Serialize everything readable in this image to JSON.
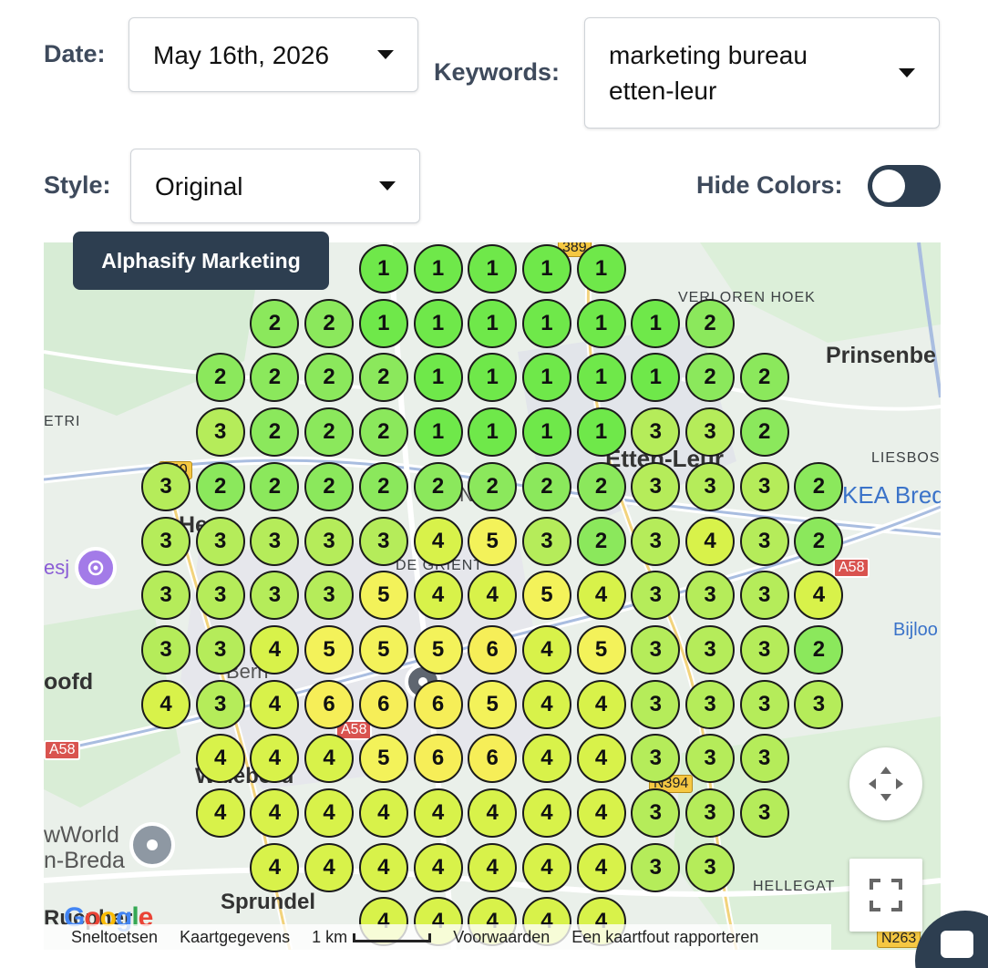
{
  "controls": {
    "date_label": "Date:",
    "date_value": "May 16th, 2026",
    "keywords_label": "Keywords:",
    "keywords_value": "marketing bureau\netten-leur",
    "style_label": "Style:",
    "style_value": "Original",
    "hide_colors_label": "Hide Colors:",
    "hide_colors_on": false
  },
  "map": {
    "tooltip": "Alphasify Marketing",
    "labels": {
      "verloren_hoek": "VERLOREN HOEK",
      "prinsenbeek": "Prinsenbe",
      "etri": "ETRI",
      "liesbos": "LIESBOS",
      "etten_leur": "Etten-Leur",
      "ikea": "KEA Bred",
      "de_grient": "DE GRIENT",
      "bijloop": "Bijloo",
      "hoofd": "oofd",
      "newworld": "wWorld\nn-Breda",
      "hellegat": "HELLEGAT",
      "sprundel": "Sprundel",
      "rucphen": "Rucpher",
      "road_a58_right": "A58",
      "road_a58_left": "A58",
      "road_a58_mid": "A58",
      "road_n394": "N394",
      "road_n263": "N263",
      "road_a389": "389",
      "road_n640": "640",
      "esj": "esj",
      "hoeven": "He",
      "bern": "Bern",
      "leur_mid": "N",
      "wouw": "Walebord"
    },
    "attribution": {
      "shortcuts": "Sneltoetsen",
      "map_data": "Kaartgegevens",
      "scale": "1 km",
      "terms": "Voorwaarden",
      "report": "Een kaartfout rapporteren"
    },
    "colors": {
      "1": "#6fe84a",
      "2": "#8be85c",
      "3": "#b5ec5a",
      "4": "#d8f24a",
      "5": "#f3f25a",
      "6": "#f6ee58"
    }
  },
  "grid": {
    "cols": 13,
    "rows": [
      [
        null,
        null,
        null,
        null,
        1,
        1,
        1,
        1,
        1,
        null,
        null,
        null,
        null
      ],
      [
        null,
        null,
        2,
        2,
        1,
        1,
        1,
        1,
        1,
        1,
        2,
        null,
        null
      ],
      [
        null,
        2,
        2,
        2,
        2,
        1,
        1,
        1,
        1,
        1,
        2,
        2,
        null
      ],
      [
        null,
        3,
        2,
        2,
        2,
        1,
        1,
        1,
        1,
        3,
        3,
        2,
        null
      ],
      [
        3,
        2,
        2,
        2,
        2,
        2,
        2,
        2,
        2,
        3,
        3,
        3,
        2
      ],
      [
        3,
        3,
        3,
        3,
        3,
        4,
        5,
        3,
        2,
        3,
        4,
        3,
        2
      ],
      [
        3,
        3,
        3,
        3,
        5,
        4,
        4,
        5,
        4,
        3,
        3,
        3,
        4
      ],
      [
        3,
        3,
        4,
        5,
        5,
        5,
        6,
        4,
        5,
        3,
        3,
        3,
        2
      ],
      [
        4,
        3,
        4,
        6,
        6,
        6,
        5,
        4,
        4,
        3,
        3,
        3,
        3
      ],
      [
        null,
        4,
        4,
        4,
        5,
        6,
        6,
        4,
        4,
        3,
        3,
        3,
        null
      ],
      [
        null,
        4,
        4,
        4,
        4,
        4,
        4,
        4,
        4,
        3,
        3,
        3,
        null
      ],
      [
        null,
        null,
        4,
        4,
        4,
        4,
        4,
        4,
        4,
        3,
        3,
        null,
        null
      ],
      [
        null,
        null,
        null,
        null,
        4,
        4,
        4,
        4,
        4,
        null,
        null,
        null,
        null
      ]
    ]
  }
}
